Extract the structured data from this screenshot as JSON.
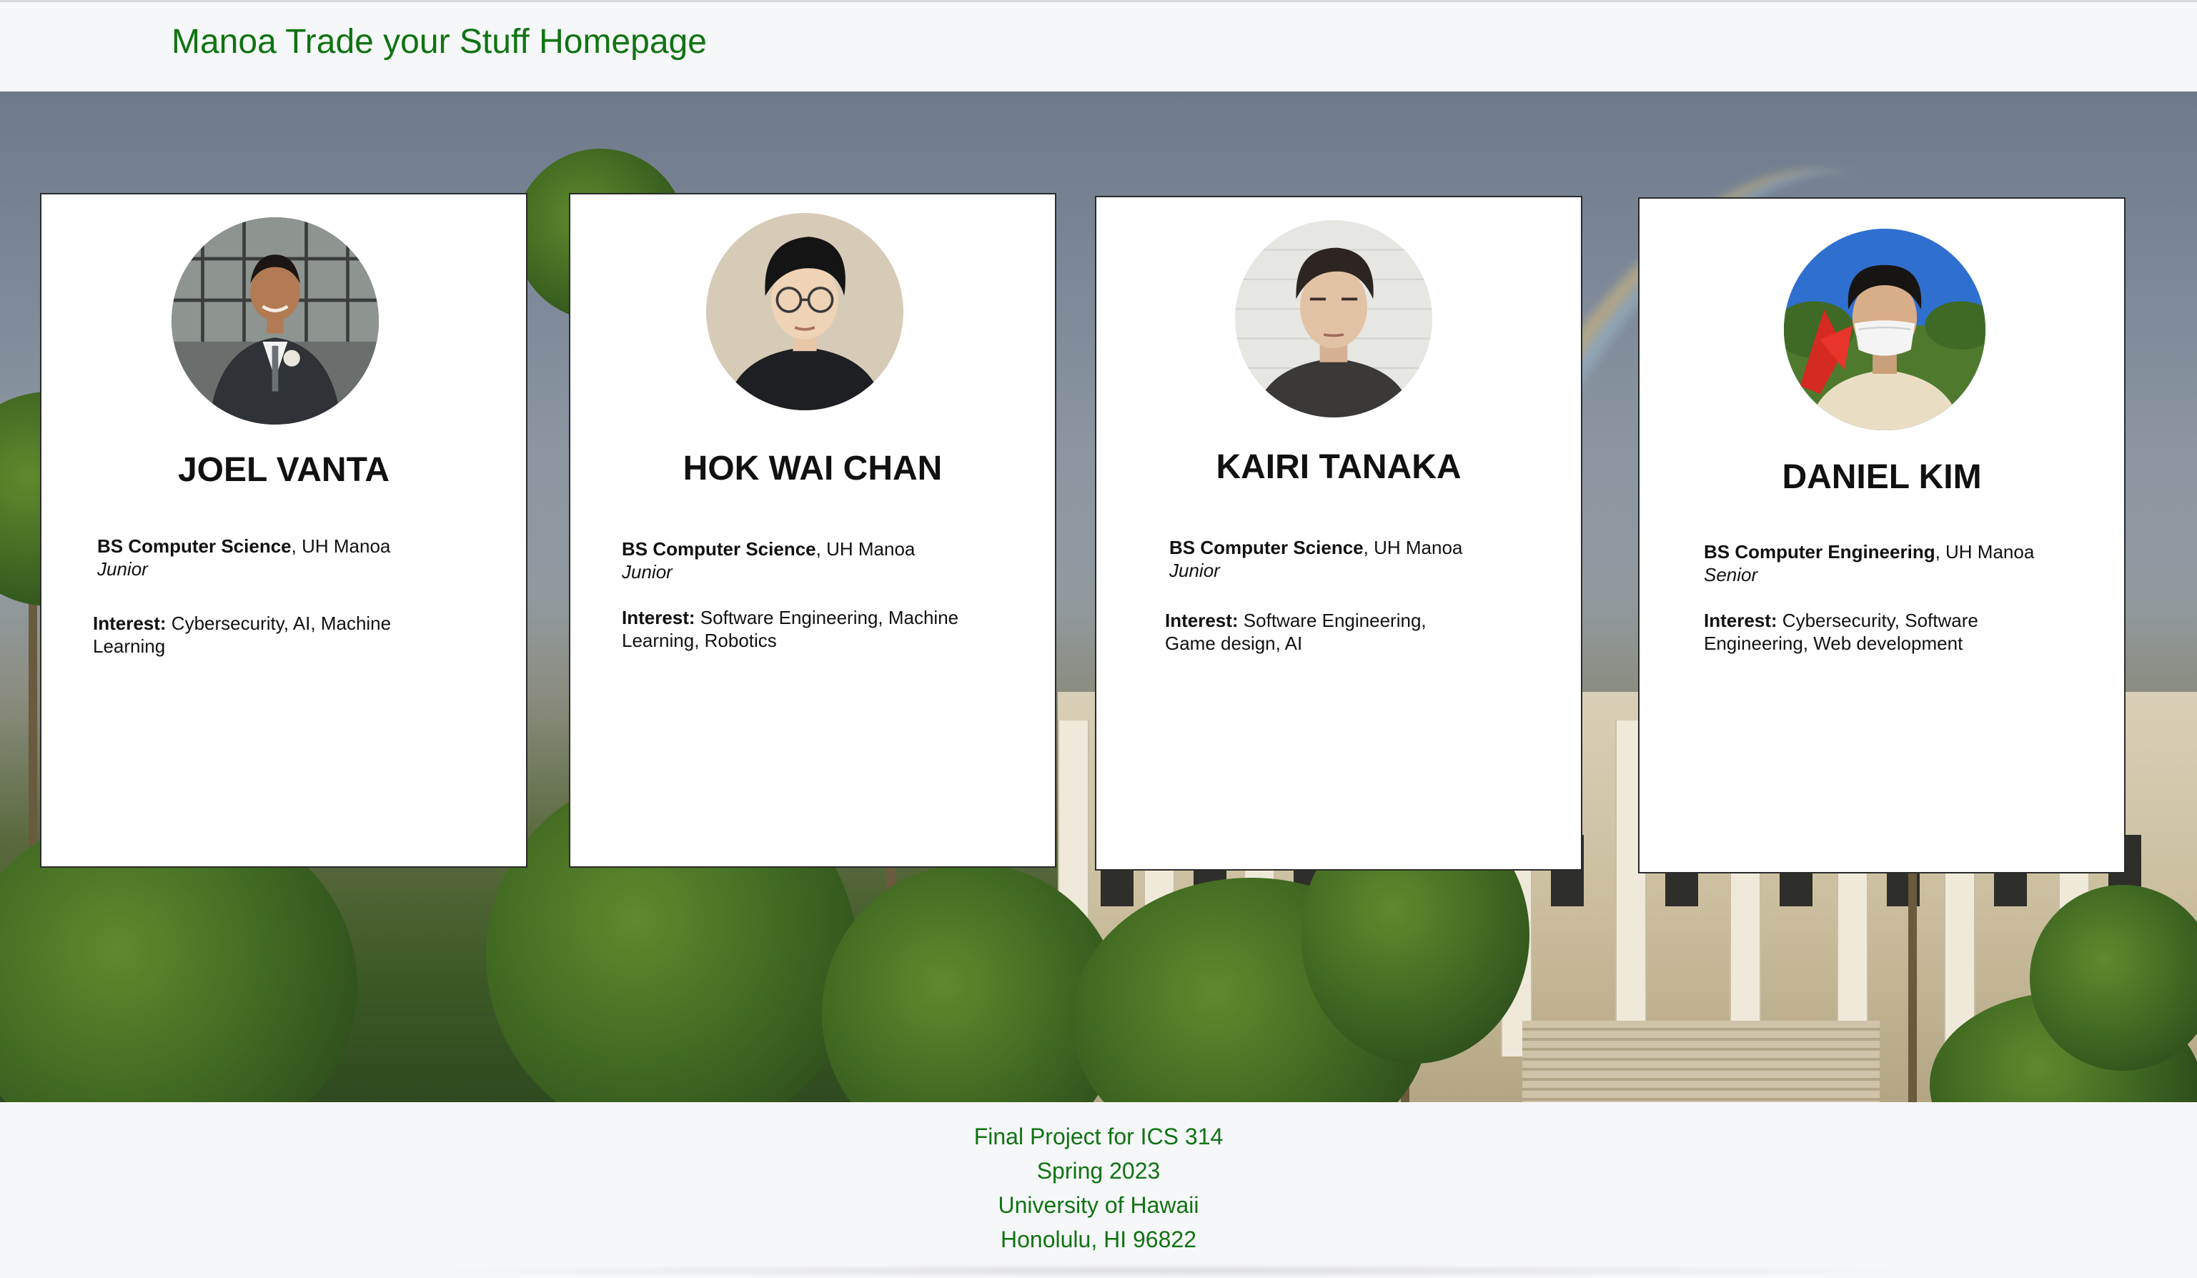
{
  "navbar": {
    "brand": "Manoa Trade your Stuff Homepage"
  },
  "team": [
    {
      "name": "JOEL VANTA",
      "degree": "BS Computer Science",
      "school": ", UH Manoa",
      "year": "Junior",
      "interest_label": "Interest:",
      "interest_text": " Cybersecurity, AI, Machine Learning"
    },
    {
      "name": "HOK WAI CHAN",
      "degree": "BS Computer Science",
      "school": ", UH Manoa",
      "year": "Junior",
      "interest_label": "Interest:",
      "interest_text": " Software Engineering, Machine Learning, Robotics"
    },
    {
      "name": "KAIRI TANAKA",
      "degree": "BS Computer Science",
      "school": ", UH Manoa",
      "year": "Junior",
      "interest_label": "Interest:",
      "interest_text": " Software Engineering, Game design, AI"
    },
    {
      "name": "DANIEL KIM",
      "degree": "BS Computer Engineering",
      "school": ", UH Manoa",
      "year": "Senior",
      "interest_label": "Interest:",
      "interest_text": " Cybersecurity, Software Engineering, Web development"
    }
  ],
  "footer": {
    "line1": "Final Project for ICS 314",
    "line2": "Spring 2023",
    "line3": "University of Hawaii",
    "line4": "Honolulu, HI 96822"
  },
  "colors": {
    "brand_green": "#107312",
    "card_border": "#2b2b2b",
    "page_bg": "#f6f7f9"
  }
}
